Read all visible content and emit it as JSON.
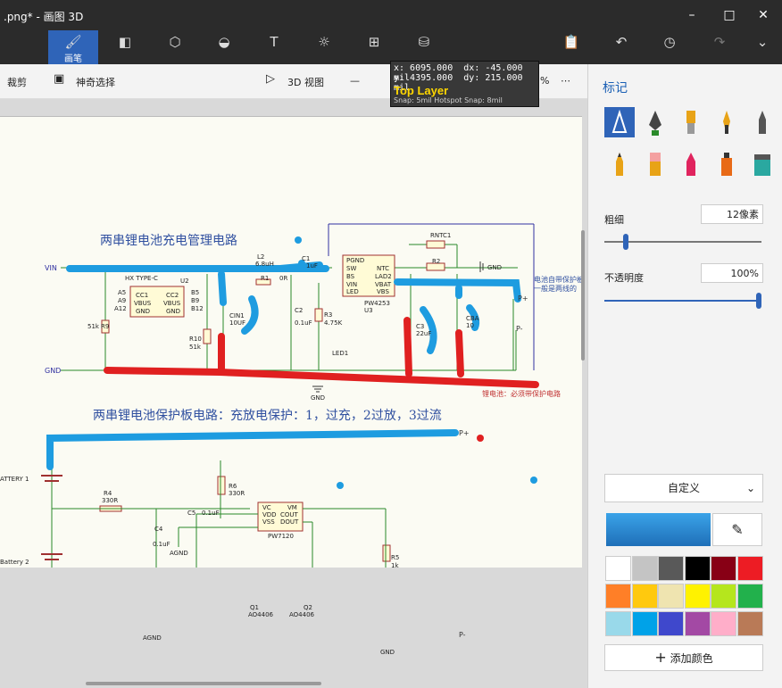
{
  "window": {
    "title": ".png* - 画图 3D"
  },
  "toolbar": {
    "tools": [
      {
        "id": "brush",
        "label": "画笔",
        "icon": "brush-icon",
        "active": true
      },
      {
        "id": "shapes2d",
        "label": "",
        "icon": "2d-shapes-icon"
      },
      {
        "id": "shapes3d",
        "label": "",
        "icon": "3d-shapes-icon"
      },
      {
        "id": "stickers",
        "label": "",
        "icon": "stickers-icon"
      },
      {
        "id": "text",
        "label": "",
        "icon": "text-icon"
      },
      {
        "id": "effects",
        "label": "",
        "icon": "effects-icon"
      },
      {
        "id": "canvas",
        "label": "",
        "icon": "canvas-icon"
      },
      {
        "id": "library",
        "label": "",
        "icon": "3d-library-icon"
      }
    ],
    "right": [
      "paste-icon",
      "undo-icon",
      "history-icon",
      "redo-icon",
      "expand-icon"
    ]
  },
  "subbar": {
    "crop": "裁剪",
    "magic_select": "神奇选择",
    "view3d": "3D 视图",
    "zoom_pct": "%"
  },
  "coord": {
    "x": "x:  6095.000",
    "dx": "dx:   -45.000 mil",
    "y": "y:  4395.000",
    "dy": "dy:   215.000 mil",
    "layer": "Top Layer",
    "snap": "Snap: 5mil Hotspot Snap: 8mil"
  },
  "schematic": {
    "title1": "两串锂电池充电管理电路",
    "title2": "两串锂电池保护板电路：充放电保护：1，过充，2过放，3过流",
    "note_red": "锂电池：必须带保护电路",
    "note_blue1": "电池自带保护板",
    "note_blue2": "一般是两线的",
    "labels": {
      "vin": "VIN",
      "gnd": "GND",
      "pplus": "P+",
      "pminus": "P-",
      "u2": "U2",
      "hx": "HX TYPE-C",
      "u3": "U3",
      "pw4253": "PW4253",
      "l2": "L2",
      "l2v": "6.8uH",
      "c1": "C1",
      "c1v": "1uF",
      "r1": "R1",
      "r1v": "0R",
      "rntc": "RNTC1",
      "r2": "R2",
      "gnd_sym": "GND",
      "cin1": "CIN1",
      "cin1v": "10UF",
      "c2": "C2",
      "c2v": "0.1uF",
      "r3": "R3",
      "r3v": "4.75K",
      "led1": "LED1",
      "c3": "C3",
      "c3v": "22uF",
      "cba": "CBA",
      "cbav": "10",
      "r9v": "51k",
      "r9": "R9",
      "r10": "R10",
      "r10v": "51k",
      "battery1": "ATTERY 1",
      "battery2": "Battery 2",
      "r4": "R4",
      "r4v": "330R",
      "r6": "R6",
      "r6v": "330R",
      "c5": "C5",
      "c5v": "0.1uF",
      "c4": "C4",
      "c4v": "0.1uF",
      "agnd": "AGND",
      "pw7120": "PW7120",
      "r5": "R5",
      "r5v": "1k",
      "q1": "Q1",
      "q2": "Q2",
      "ao4406": "AO4406",
      "pin_pgnd": "PGND",
      "pin_sw": "SW",
      "pin_bs": "BS",
      "pin_vin": "VIN",
      "pin_led": "LED",
      "pin_ntc": "NTC",
      "pin_lad2": "LAD2",
      "pin_vbat": "VBAT",
      "pin_vbs": "VBS",
      "pin_cc1": "CC1",
      "pin_cc2": "CC2",
      "pin_vbus": "VBUS",
      "pin_gnd": "GND",
      "pin_a5": "A5",
      "pin_a9": "A9",
      "pin_a12": "A12",
      "pin_b5": "B5",
      "pin_b9": "B9",
      "pin_b12": "B12",
      "pin_vc": "VC",
      "pin_vdd": "VDD",
      "pin_vss": "VSS",
      "pin_vm": "VM",
      "pin_cout": "COUT",
      "pin_dout": "DOUT"
    }
  },
  "panel": {
    "title": "标记",
    "brushes": [
      "marker-icon",
      "calligraphy-pen-icon",
      "oil-brush-icon",
      "watercolor-icon",
      "pixel-pen-icon",
      "pencil-icon",
      "eraser-icon",
      "crayon-icon",
      "spray-can-icon",
      "fill-icon"
    ],
    "thickness_label": "粗细",
    "thickness_value": "12像素",
    "thickness_level": 0.12,
    "opacity_label": "不透明度",
    "opacity_value": "100%",
    "opacity_level": 1.0,
    "color_mode": "自定义",
    "current_color": "#2b8fd8",
    "palette": [
      "#ffffff",
      "#c4c4c4",
      "#595959",
      "#000000",
      "#880015",
      "#ed1c24",
      "#ff7f27",
      "#ffc90e",
      "#efe4b0",
      "#fff200",
      "#b5e61d",
      "#22b14c",
      "#99d9ea",
      "#00a2e8",
      "#3f48cc",
      "#a349a4",
      "#ffaec9",
      "#b97a57"
    ],
    "add_color": "添加颜色"
  }
}
